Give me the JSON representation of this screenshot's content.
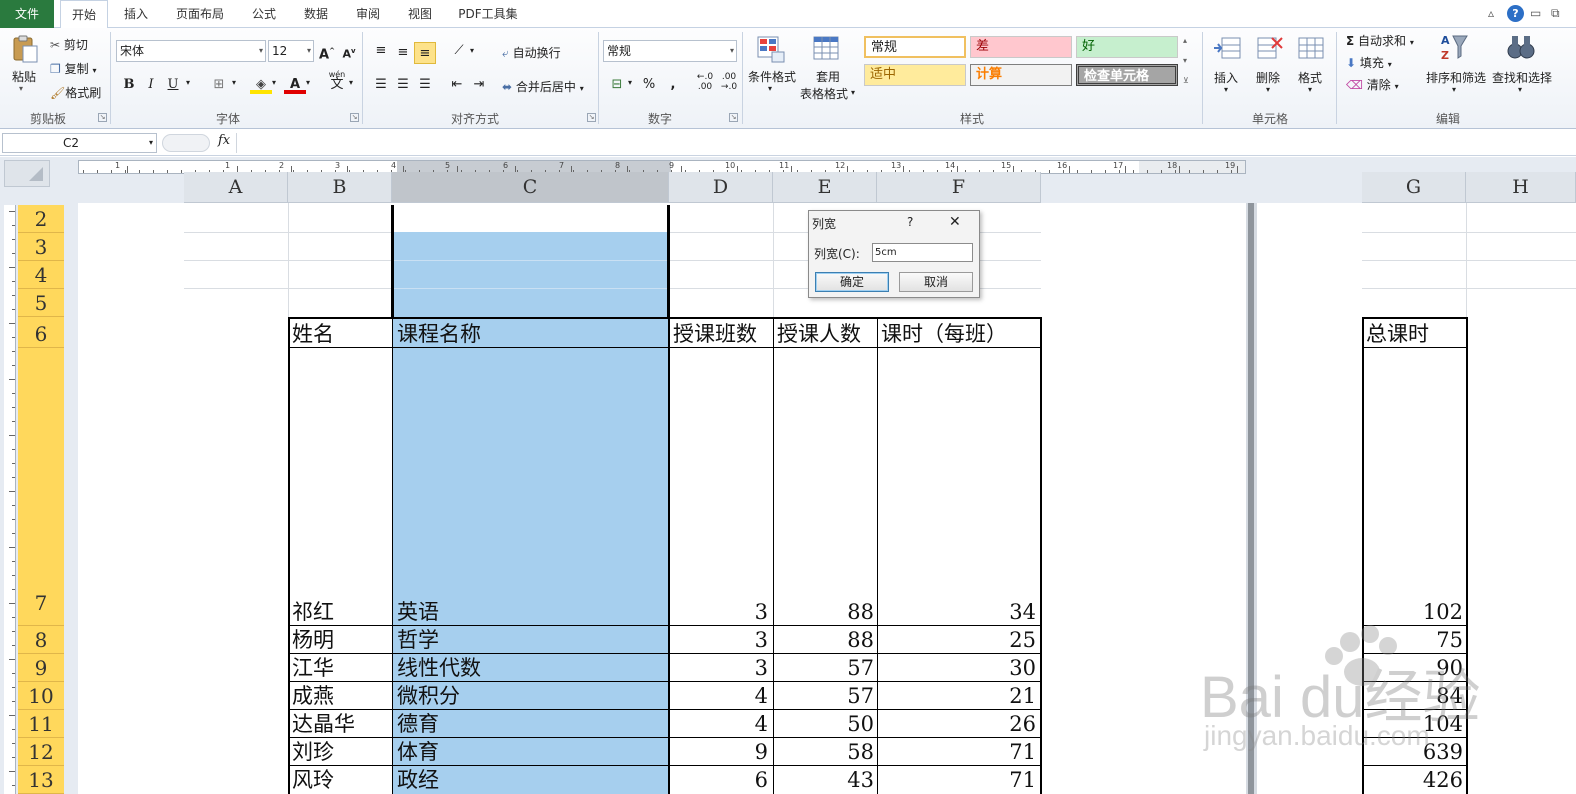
{
  "tabs": [
    "文件",
    "开始",
    "插入",
    "页面布局",
    "公式",
    "数据",
    "审阅",
    "视图",
    "PDF工具集"
  ],
  "active_tab": "开始",
  "ribbon": {
    "clipboard": {
      "paste": "粘贴",
      "cut": "剪切",
      "copy": "复制",
      "format_painter": "格式刷",
      "label": "剪贴板"
    },
    "font": {
      "name": "宋体",
      "size": "12",
      "bold": "B",
      "italic": "I",
      "underline": "U",
      "grow": "A",
      "shrink": "A",
      "font_color": "A",
      "wen": "wén",
      "label": "字体"
    },
    "align": {
      "wrap": "自动换行",
      "merge": "合并后居中",
      "label": "对齐方式"
    },
    "number": {
      "format": "常规",
      "percent": "%",
      "comma": ",",
      "inc": "+.0\n.00",
      "dec": ".00\n→.0",
      "label": "数字"
    },
    "styles": {
      "cond_format": "条件格式",
      "table_format_1": "套用",
      "table_format_2": "表格格式",
      "items": [
        "常规",
        "差",
        "好",
        "适中",
        "计算",
        "检查单元格"
      ],
      "label": "样式"
    },
    "cells": {
      "insert": "插入",
      "delete": "删除",
      "format": "格式",
      "label": "单元格"
    },
    "editing": {
      "autosum": "自动求和",
      "fill": "填充",
      "clear": "清除",
      "sort": "排序和筛选",
      "find": "查找和选择",
      "label": "编辑"
    }
  },
  "formula_bar": {
    "name_box": "C2",
    "fx": "fx",
    "formula": ""
  },
  "ruler_numbers": [
    "1",
    "1",
    "2",
    "3",
    "4",
    "5",
    "6",
    "7",
    "8",
    "9",
    "10",
    "11",
    "12",
    "13",
    "14",
    "15",
    "16",
    "17",
    "18",
    "19"
  ],
  "columns": [
    "A",
    "B",
    "C",
    "D",
    "E",
    "F",
    "G",
    "H"
  ],
  "rows": [
    "2",
    "3",
    "4",
    "5",
    "6",
    "7",
    "8",
    "9",
    "10",
    "11",
    "12",
    "13"
  ],
  "table": {
    "headers": [
      "姓名",
      "课程名称",
      "授课班数",
      "授课人数",
      "课时（每班）",
      "总课时"
    ],
    "rows": [
      [
        "祁红",
        "英语",
        "3",
        "88",
        "34",
        "102"
      ],
      [
        "杨明",
        "哲学",
        "3",
        "88",
        "25",
        "75"
      ],
      [
        "江华",
        "线性代数",
        "3",
        "57",
        "30",
        "90"
      ],
      [
        "成燕",
        "微积分",
        "4",
        "57",
        "21",
        "84"
      ],
      [
        "达晶华",
        "德育",
        "4",
        "50",
        "26",
        "104"
      ],
      [
        "刘珍",
        "体育",
        "9",
        "58",
        "71",
        "639"
      ],
      [
        "风玲",
        "政经",
        "6",
        "43",
        "71",
        "426"
      ]
    ]
  },
  "dialog": {
    "title": "列宽",
    "help": "?",
    "close": "✕",
    "label": "列宽(C):",
    "value": "5cm",
    "ok": "确定",
    "cancel": "取消"
  },
  "watermark": {
    "brand": "Bai du经验",
    "url": "jingyan.baidu.com"
  },
  "colors": {
    "file_tab": "#2a7a3e",
    "selection": "#a6cfee",
    "row_header": "#ffd85c"
  }
}
